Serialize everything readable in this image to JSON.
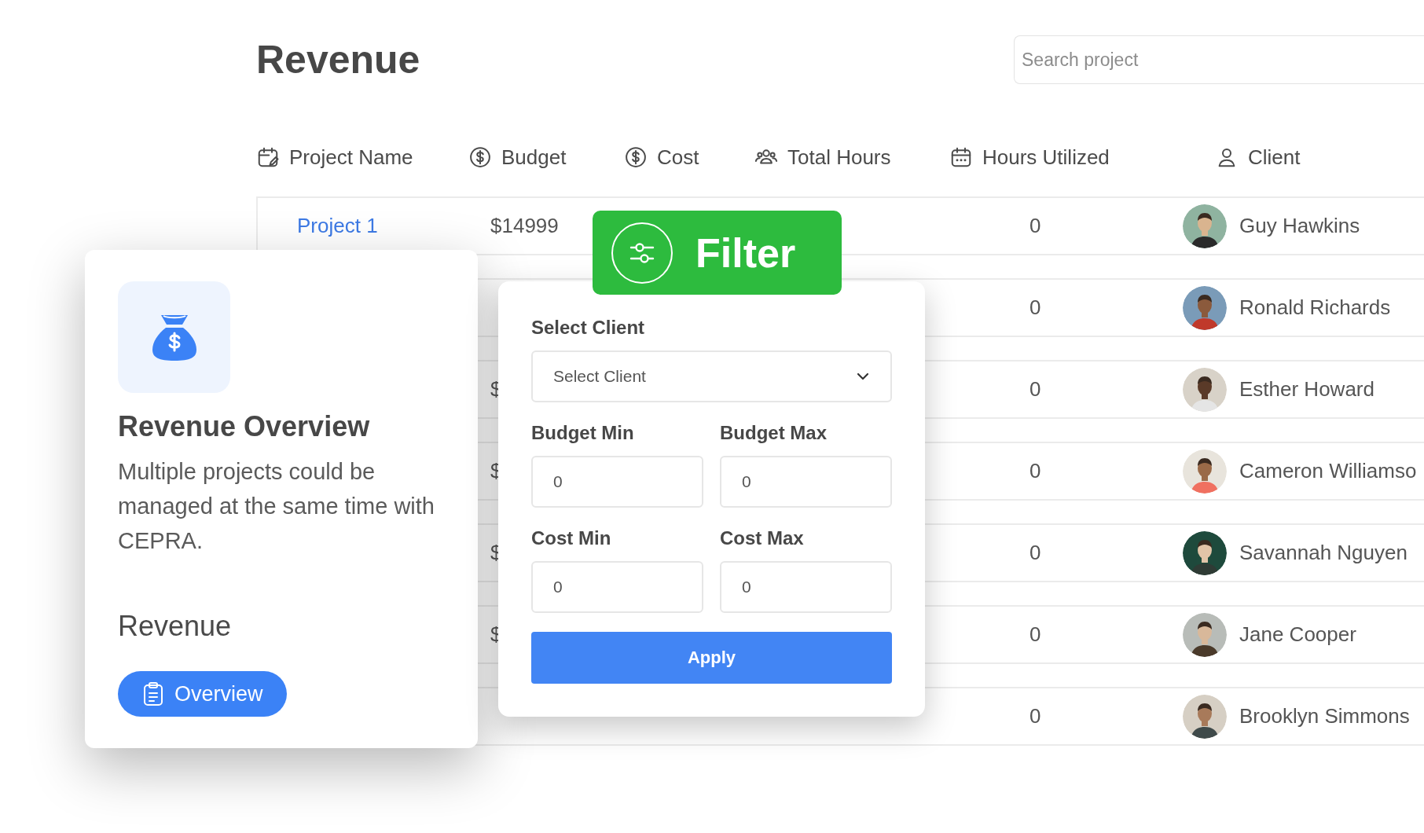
{
  "page": {
    "title": "Revenue",
    "search": {
      "placeholder": "Search project"
    }
  },
  "table": {
    "columns": [
      {
        "label": "Project Name"
      },
      {
        "label": "Budget"
      },
      {
        "label": "Cost"
      },
      {
        "label": "Total Hours"
      },
      {
        "label": "Hours Utilized"
      },
      {
        "label": "Client"
      }
    ],
    "rows": [
      {
        "project": "Project 1",
        "budget": "$14999",
        "hours_utilized": "0",
        "client": "Guy Hawkins"
      },
      {
        "hours_utilized": "0",
        "client": "Ronald Richards"
      },
      {
        "budget": "$",
        "hours_utilized": "0",
        "client": "Esther Howard"
      },
      {
        "budget": "$",
        "hours_utilized": "0",
        "client": "Cameron Williamso"
      },
      {
        "budget": "$",
        "hours_utilized": "0",
        "client": "Savannah Nguyen"
      },
      {
        "budget": "$",
        "hours_utilized": "0",
        "client": "Jane Cooper"
      },
      {
        "hours_utilized": "0",
        "client": "Brooklyn Simmons"
      }
    ]
  },
  "overview_card": {
    "title": "Revenue Overview",
    "description": "Multiple projects could be managed at the same time with CEPRA.",
    "section": "Revenue",
    "button": "Overview"
  },
  "filter_badge": {
    "label": "Filter"
  },
  "filter_panel": {
    "client_label": "Select Client",
    "client_select": "Select Client",
    "fields": [
      {
        "label": "Budget Min",
        "value": "0"
      },
      {
        "label": "Budget Max",
        "value": "0"
      },
      {
        "label": "Cost Min",
        "value": "0"
      },
      {
        "label": "Cost Max",
        "value": "0"
      }
    ],
    "apply": "Apply"
  }
}
